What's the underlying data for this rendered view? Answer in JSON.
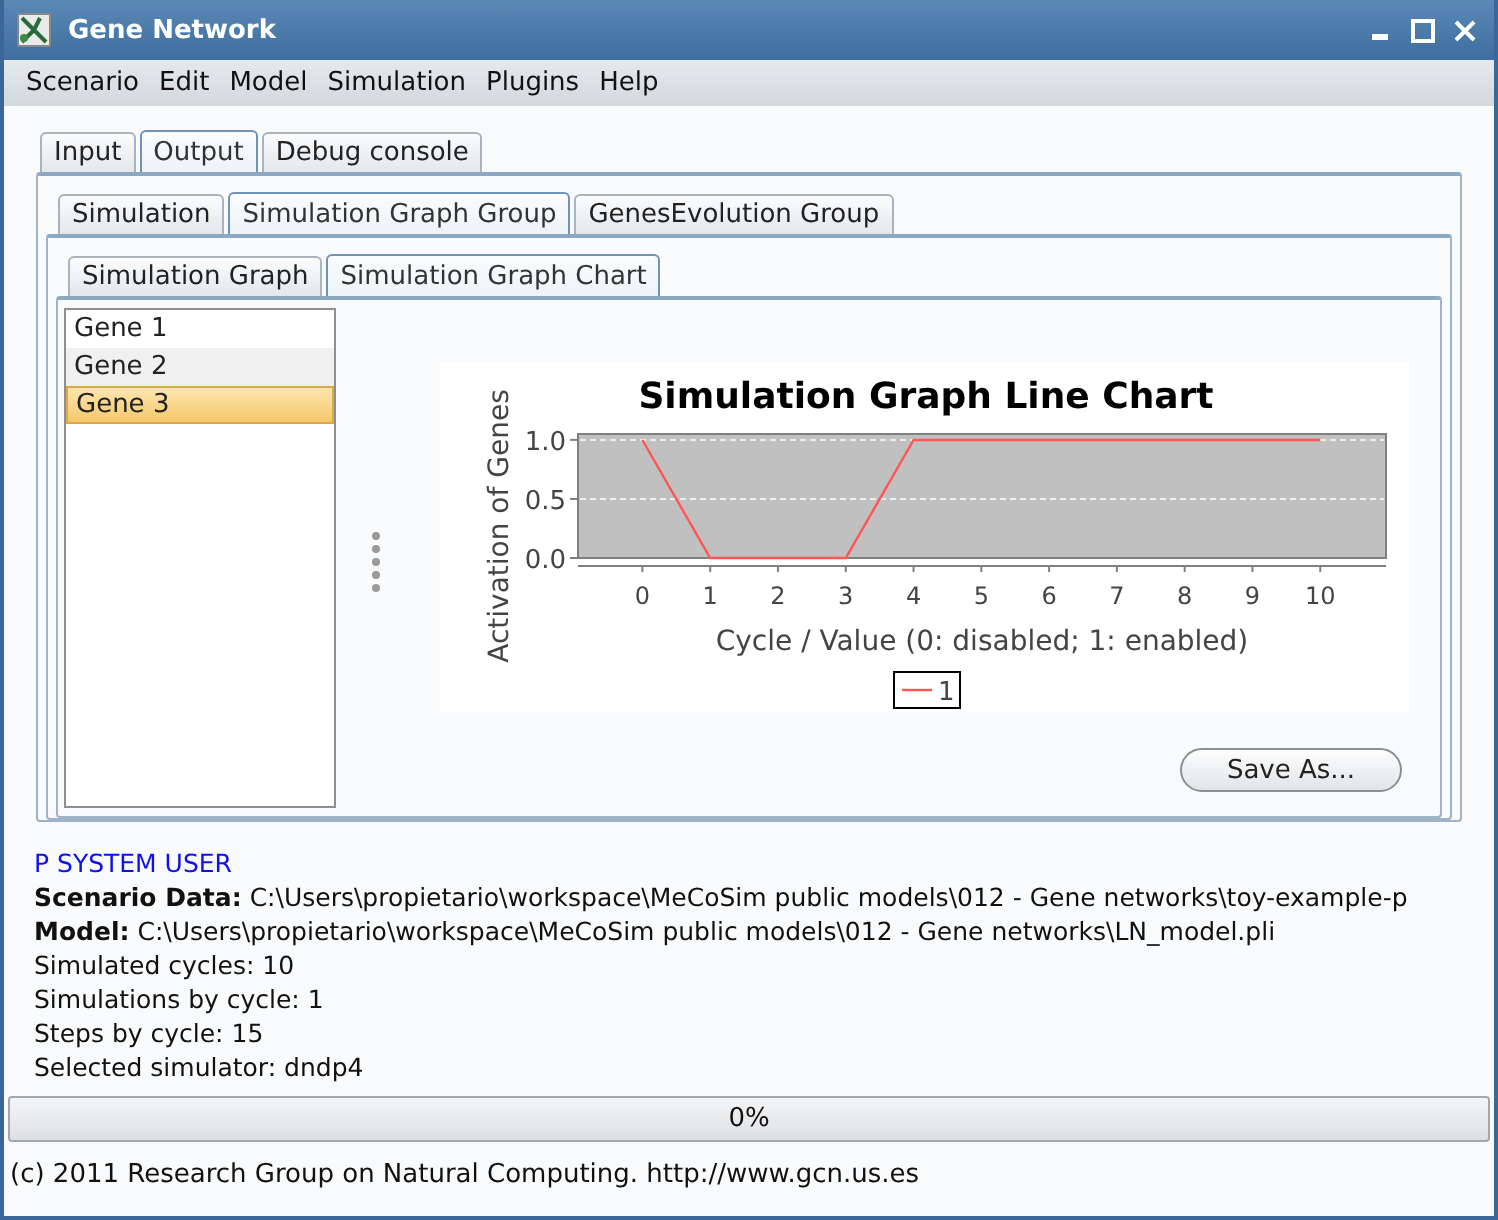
{
  "window": {
    "title": "Gene Network"
  },
  "menu": [
    "Scenario",
    "Edit",
    "Model",
    "Simulation",
    "Plugins",
    "Help"
  ],
  "tabs": [
    {
      "label": "Input",
      "selected": false
    },
    {
      "label": "Output",
      "selected": true
    },
    {
      "label": "Debug console",
      "selected": false
    }
  ],
  "output_tabs": [
    {
      "label": "Simulation",
      "selected": false
    },
    {
      "label": "Simulation Graph Group",
      "selected": true
    },
    {
      "label": "GenesEvolution Group",
      "selected": false
    }
  ],
  "graph_tabs": [
    {
      "label": "Simulation Graph",
      "selected": false
    },
    {
      "label": "Simulation Graph Chart",
      "selected": true
    }
  ],
  "genes": [
    {
      "label": "Gene 1",
      "selected": false
    },
    {
      "label": "Gene 2",
      "selected": false
    },
    {
      "label": "Gene 3",
      "selected": true
    }
  ],
  "chart_data": {
    "type": "line",
    "title": "Simulation Graph Line Chart",
    "xlabel": "Cycle / Value (0: disabled; 1: enabled)",
    "ylabel": "Activation of Genes",
    "x": [
      0,
      1,
      2,
      3,
      4,
      5,
      6,
      7,
      8,
      9,
      10
    ],
    "series": [
      {
        "name": "1",
        "color": "#ff5555",
        "values": [
          1,
          0,
          0,
          0,
          1,
          1,
          1,
          1,
          1,
          1,
          1
        ]
      }
    ],
    "xlim": [
      -0.95,
      10.97
    ],
    "ylim": [
      0,
      1.05
    ],
    "xticks": [
      0,
      1,
      2,
      3,
      4,
      5,
      6,
      7,
      8,
      9,
      10
    ],
    "yticks": [
      {
        "value": 0,
        "label": "0.0"
      },
      {
        "value": 0.5,
        "label": "0.5"
      },
      {
        "value": 1,
        "label": "1.0"
      }
    ]
  },
  "save_button": "Save As...",
  "log": [
    {
      "kind": "header",
      "text": "P SYSTEM USER"
    },
    {
      "kind": "line",
      "text": "**Scenario Data:** C:\\Users\\propietario\\workspace\\MeCoSim public models\\012 - Gene networks\\toy-example-p"
    },
    {
      "kind": "line",
      "text": "**Model:** C:\\Users\\propietario\\workspace\\MeCoSim public models\\012 - Gene networks\\LN_model.pli"
    },
    {
      "kind": "line",
      "text": "Simulated cycles: 10"
    },
    {
      "kind": "line",
      "text": "Simulations by cycle: 1"
    },
    {
      "kind": "line",
      "text": "Steps by cycle: 15"
    },
    {
      "kind": "line",
      "text": "Selected simulator: dndp4"
    }
  ],
  "progress": {
    "level": 0,
    "text": "0%"
  },
  "status_bar": "(c) 2011 Research Group on Natural Computing. http://www.gcn.us.es"
}
